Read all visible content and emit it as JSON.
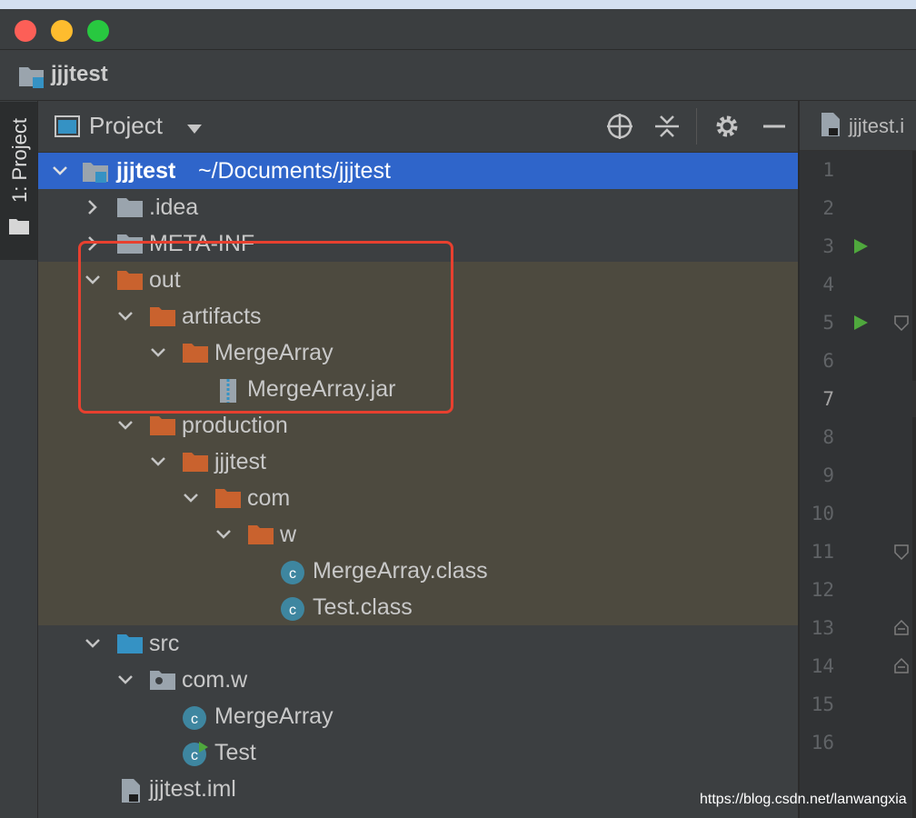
{
  "window": {
    "title": "jjjtest",
    "accent": "#2f65ca",
    "highlight_color": "#e8402f"
  },
  "sidebar": {
    "tab_label": "1: Project"
  },
  "project_panel": {
    "header_title": "Project",
    "view_dropdown_icon": "chevron-down-icon",
    "toolbar_icons": [
      "locate-icon",
      "collapse-all-icon",
      "gear-icon",
      "minimize-icon"
    ]
  },
  "tree": {
    "root": {
      "name": "jjjtest",
      "path": "~/Documents/jjjtest"
    },
    "items": [
      {
        "label": ".idea"
      },
      {
        "label": "META-INF"
      },
      {
        "label": "out"
      },
      {
        "label": "artifacts"
      },
      {
        "label": "MergeArray"
      },
      {
        "label": "MergeArray.jar"
      },
      {
        "label": "production"
      },
      {
        "label": "jjjtest"
      },
      {
        "label": "com"
      },
      {
        "label": "w"
      },
      {
        "label": "MergeArray.class"
      },
      {
        "label": "Test.class"
      },
      {
        "label": "src"
      },
      {
        "label": "com.w"
      },
      {
        "label": "MergeArray"
      },
      {
        "label": "Test"
      },
      {
        "label": "jjjtest.iml"
      }
    ]
  },
  "editor": {
    "tab_label": "jjjtest.i",
    "line_numbers": [
      "1",
      "2",
      "3",
      "4",
      "5",
      "6",
      "7",
      "8",
      "9",
      "10",
      "11",
      "12",
      "13",
      "14",
      "15",
      "16"
    ],
    "current_line": "7"
  },
  "watermark": "https://blog.csdn.net/lanwangxia"
}
